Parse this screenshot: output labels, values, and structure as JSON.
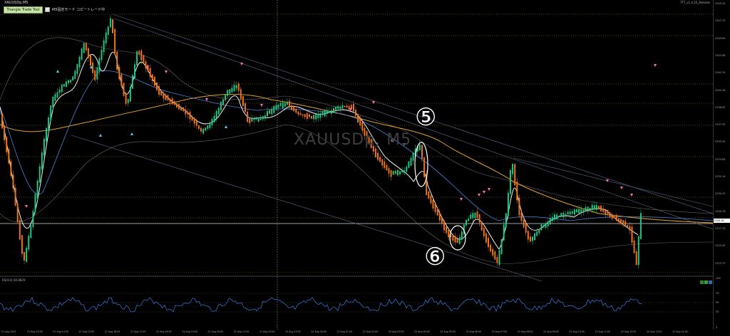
{
  "header": {
    "symbol": "XAUUSDp,M5",
    "version": "TTT_v1.4.25_Release"
  },
  "toolbar": {
    "button_label": "Triangle Trade Tool",
    "mode_text": "M5固定モード コピートレード中"
  },
  "chart": {
    "watermark": "XAUUSDp, M5",
    "annotation_5": "⑤",
    "annotation_6": "⑥",
    "current_price": "2328.18",
    "price_ticks": [
      "2349.15",
      "2347.33",
      "2345.65",
      "2343.98",
      "2342.25",
      "2340.56",
      "2338.83",
      "2337.20",
      "2335.50",
      "2333.84",
      "2332.14",
      "2330.47",
      "2328.78",
      "2327.10",
      "2325.40",
      "2323.73"
    ],
    "candle_colors": {
      "up": "#26c281",
      "down": "#e8731f",
      "ma_slow": "#e0a030",
      "ma_fast": "#ffffff",
      "ma_mid": "#4a7fd4",
      "band": "#555555"
    },
    "arrow_colors": {
      "sell": "#ff6fb0",
      "buy": "#4fd0e8"
    }
  },
  "rsi": {
    "label": "RSI(14) 60.8829",
    "ticks": [
      "100",
      "70",
      "50",
      "30",
      "0"
    ]
  },
  "time_axis": {
    "ticks": [
      "21 Aug 2023",
      "21 Aug 13:00",
      "21 Aug 14:00",
      "21 Aug 15:00",
      "21 Aug 16:00",
      "21 Aug 17:00",
      "21 Aug 18:00",
      "21 Aug 19:00",
      "21 Aug 20:00",
      "21 Aug 21:00",
      "21 Aug 22:00",
      "21 Aug 23:00",
      "22 Aug 00:00",
      "22 Aug 01:00",
      "22 Aug 02:00",
      "22 Aug 03:00",
      "22 Aug 04:00",
      "22 Aug 05:00",
      "22 Aug 06:00",
      "22 Aug 07:00",
      "22 Aug 08:00",
      "22 Aug 09:00",
      "22 Aug 10:00",
      "22 Aug 11:00",
      "22 Aug 12:00",
      "22 Aug 13:00",
      "22 Aug 14:00"
    ]
  }
}
